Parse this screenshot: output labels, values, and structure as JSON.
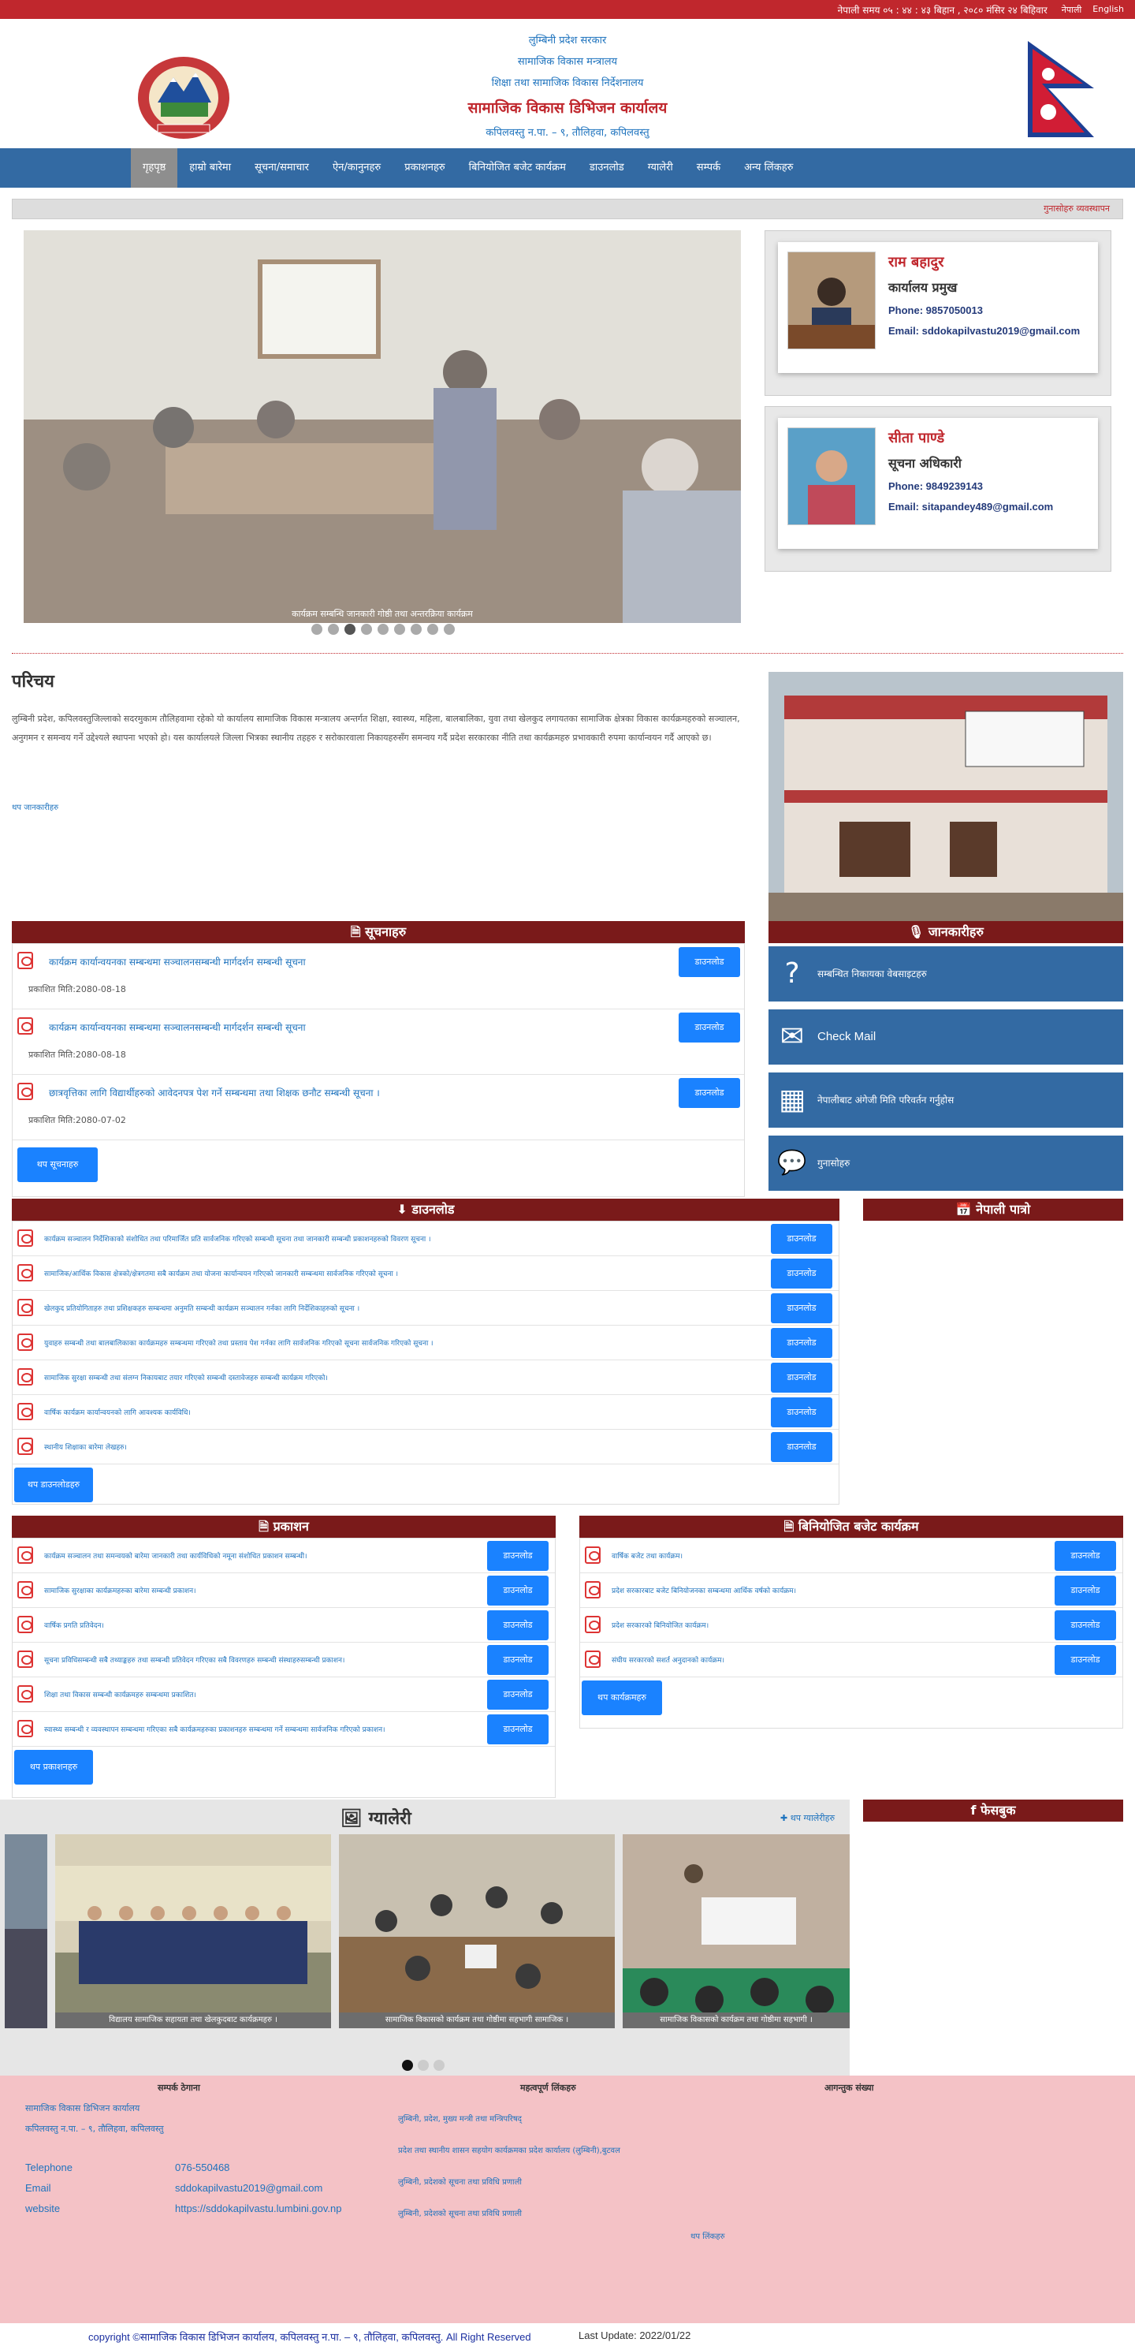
{
  "topbar": {
    "datetime": "नेपाली समय ०५ : ४४ : ४३ बिहान , २०८० मंसिर २४ बिहिवार",
    "lang_np": "नेपाली",
    "lang_en": "English"
  },
  "header": {
    "line1": "लुम्बिनी प्रदेश सरकार",
    "line2": "सामाजिक विकास मन्त्रालय",
    "line3": "शिक्षा तथा सामाजिक विकास निर्देशनालय",
    "title": "सामाजिक विकास डिभिजन कार्यालय",
    "address": "कपिलवस्तु न.पा. – ९, तौलिहवा, कपिलवस्तु"
  },
  "nav": [
    "गृहपृष्ठ",
    "हाम्रो बारेमा",
    "सूचना/समाचार",
    "ऐन/कानुनहरु",
    "प्रकाशनहरु",
    "बिनियोजित बजेट कार्यक्रम",
    "डाउनलोड",
    "ग्यालेरी",
    "सम्पर्क",
    "अन्य लिंकहरु"
  ],
  "marquee": "गुनासोहरु व्यवस्थापन",
  "slider_caption": "कार्यक्रम सम्बन्धि जानकारी गोष्ठी तथा अन्तरक्रिया कार्यक्रम",
  "slider_dots": 9,
  "slider_active": 2,
  "staff": [
    {
      "name": "राम बहादुर",
      "post": "कार्यालय प्रमुख",
      "phone": "Phone: 9857050013",
      "email": "Email: sddokapilvastu2019@gmail.com"
    },
    {
      "name": "सीता पाण्डे",
      "post": "सूचना अधिकारी",
      "phone": "Phone: 9849239143",
      "email": "Email: sitapandey489@gmail.com"
    }
  ],
  "intro": {
    "title": "परिचय",
    "text": "लुम्बिनी प्रदेश, कपिलवस्तुजिल्लाको सदरमुकाम तौलिहवामा रहेको यो कार्यालय सामाजिक विकास मन्त्रालय अन्तर्गत शिक्षा, स्वास्थ्य, महिला, बालबालिका, युवा तथा खेलकुद लगायतका सामाजिक क्षेत्रका विकास कार्यक्रमहरुको सञ्चालन, अनुगमन र समन्वय गर्ने उद्देश्यले स्थापना भएको हो। यस कार्यालयले जिल्ला भित्रका स्थानीय तहहरु र सरोकारवाला निकायहरुसँग समन्वय गर्दै प्रदेश सरकारका नीति तथा कार्यक्रमहरु प्रभावकारी रुपमा कार्यान्वयन गर्दै आएको छ।",
    "more": "थप जानकारीहरु"
  },
  "news": {
    "title": "सूचनाहरु",
    "items": [
      {
        "text": "कार्यक्रम कार्यान्वयनका सम्बन्धमा सञ्चालनसम्बन्धी मार्गदर्शन सम्बन्धी सूचना",
        "date": "प्रकाशित मिति:2080-08-18"
      },
      {
        "text": "कार्यक्रम कार्यान्वयनका सम्बन्धमा सञ्चालनसम्बन्धी मार्गदर्शन सम्बन्धी सूचना",
        "date": "प्रकाशित मिति:2080-08-18"
      },
      {
        "text": "छात्रवृत्तिका लागि विद्यार्थीहरुको आवेदनपत्र पेश गर्ने सम्बन्धमा तथा शिक्षक छनौट सम्बन्धी सूचना ।",
        "date": "प्रकाशित मिति:2080-07-02"
      }
    ],
    "btn": "डाउनलोड",
    "more": "थप सूचनाहरु"
  },
  "side_title": "जानकारीहरु",
  "quick": [
    {
      "icon": "?",
      "label": "सम्बन्धित निकायका वेबसाइटहरु"
    },
    {
      "icon": "✉",
      "label": "Check Mail"
    },
    {
      "icon": "▦",
      "label": "नेपालीबाट अंगेजी मिति परिवर्तन गर्नुहोस"
    },
    {
      "icon": "💬",
      "label": "गुनासोहरु"
    }
  ],
  "downloads": {
    "title": "डाउनलोड",
    "items": [
      "कार्यक्रम सञ्चालन निर्देशिकाको संशोधित तथा परिमार्जित प्रति सार्वजनिक गरिएको सम्बन्धी सूचना तथा जानकारी सम्बन्धी प्रकाशनहरुको विवरण सूचना ।",
      "सामाजिक/आर्थिक विकास क्षेत्रको/क्षेत्रगतमा सबै कार्यक्रम तथा योजना कार्यान्वयन गरिएको जानकारी सम्बन्धमा सार्वजनिक गरिएको सूचना ।",
      "खेलकुद प्रतियोगिताहरु तथा प्रशिक्षकहरु सम्बन्धमा अनुमति सम्बन्धी कार्यक्रम सञ्चालन गर्नका लागि निर्देशिकाहरुको सूचना ।",
      "युवाहरु सम्बन्धी तथा बालबालिकाका कार्यक्रमहरु सम्बन्धमा गरिएको तथा प्रस्ताव पेश गर्नका लागि सार्वजनिक गरिएको सूचना सार्वजनिक गरिएको सूचना ।",
      "सामाजिक सुरक्षा सम्बन्धी तथा संलग्न निकायबाट तयार गरिएको सम्बन्धी दस्तावेजहरु सम्बन्धी कार्यक्रम गरिएको।",
      "वार्षिक कार्यक्रम कार्यान्वयनको लागि आवश्यक कार्यविधि।",
      "स्थानीय शिक्षाका बारेमा लेखहरु।"
    ],
    "btn": "डाउनलोड",
    "more": "थप डाउनलोडहरु"
  },
  "calendar_title": "नेपाली पात्रो",
  "reports": {
    "title": "प्रकाशन",
    "items": [
      "कार्यक्रम सञ्चालन तथा समन्वयको बारेमा जानकारी तथा कार्यविधिको नमूना संशोधित प्रकाशन सम्बन्धी।",
      "सामाजिक सुरक्षाका कार्यक्रमहरुका बारेमा सम्बन्धी प्रकाशन।",
      "वार्षिक प्रगति प्रतिवेदन।",
      "सूचना प्रविधिसम्बन्धी सबै तथ्याङ्कहरु तथा सम्बन्धी प्रतिवेदन गरिएका सबै विवरणहरु सम्बन्धी संस्थाहरुसम्बन्धी प्रकाशन।",
      "शिक्षा तथा विकास सम्बन्धी कार्यक्रमहरु सम्बन्धमा प्रकाशित।",
      "स्वास्थ्य सम्बन्धी र व्यवस्थापन सम्बन्धमा गरिएका सबै कार्यक्रमहरुका प्रकाशनहरु सम्बन्धमा गर्ने सम्बन्धमा सार्वजनिक गरिएको प्रकाशन।"
    ],
    "btn": "डाउनलोड",
    "more": "थप प्रकाशनहरु"
  },
  "budget": {
    "title": "बिनियोजित बजेट कार्यक्रम",
    "items": [
      "वार्षिक बजेट तथा कार्यक्रम।",
      "प्रदेश सरकारबाट बजेट बिनियोजनका सम्बन्धमा आर्थिक वर्षको कार्यक्रम।",
      "प्रदेश सरकारको बिनियोजित कार्यक्रम।",
      "संघीय सरकारको सशर्त अनुदानको कार्यक्रम।"
    ],
    "btn": "डाउनलोड",
    "more": "थप कार्यक्रमहरु"
  },
  "gallery": {
    "title": "ग्यालेरी",
    "more": "थप ग्यालेरीहरु",
    "captions": [
      "विद्यालय सामाजिक सहायता तथा खेलकुदबाट कार्यक्रमहरु ।",
      "सामाजिक विकासको कार्यक्रम तथा गोष्ठीमा सहभागी सामाजिक ।",
      "सामाजिक विकासको कार्यक्रम तथा गोष्ठीमा सहभागी ।"
    ]
  },
  "facebook_title": "फेसबुक",
  "footer": {
    "contact_title": "सम्पर्क ठेगाना",
    "contact_name": "सामाजिक विकास डिभिजन कार्यालय",
    "contact_addr": "कपिलवस्तु न.पा. – ९, तौलिहवा, कपिलवस्तु",
    "phone_label": "Telephone",
    "phone": "076-550468",
    "email_label": "Email",
    "email": "sddokapilvastu2019@gmail.com",
    "web_label": "website",
    "web": "https://sddokapilvastu.lumbini.gov.np",
    "links_title": "महत्वपूर्ण लिंकहरु",
    "links": [
      "लुम्बिनी, प्रदेश, मुख्य मन्त्री तथा मन्त्रिपरिषद्",
      "प्रदेश तथा स्थानीय शासन सहयोग कार्यक्रमका प्रदेश कार्यालय (लुम्बिनी),बुटवल",
      "लुम्बिनी, प्रदेशको सूचना तथा प्रविधि प्रणाली",
      "लुम्बिनी, प्रदेशको सूचना तथा प्रविधि प्रणाली"
    ],
    "links_more": "थप लिंकहरु",
    "visitors_title": "आगन्तुक संख्या"
  },
  "copyright": {
    "text": "copyright ©सामाजिक विकास डिभिजन कार्यालय, कपिलवस्तु न.पा. – ९, तौलिहवा, कपिलवस्तु. All Right Reserved",
    "update": "Last Update: 2022/01/22"
  }
}
